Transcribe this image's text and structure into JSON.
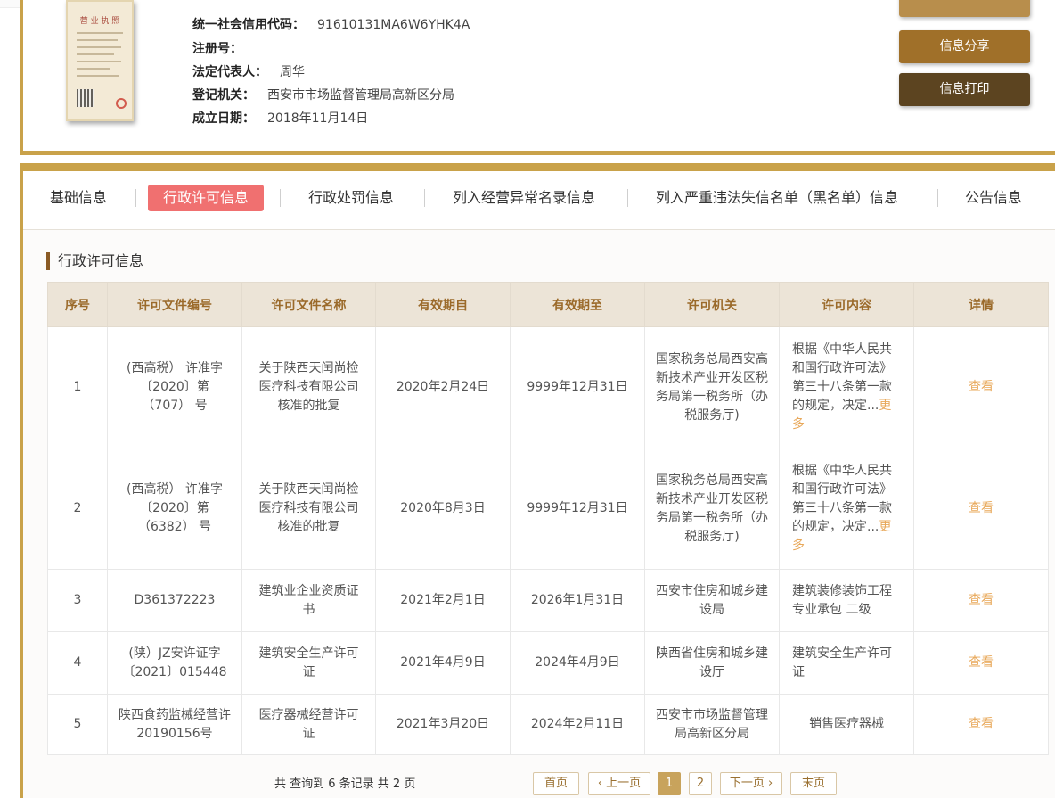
{
  "company_info": {
    "credit_code_label": "统一社会信用代码：",
    "credit_code_value": "91610131MA6W6YHK4A",
    "reg_no_label": "注册号：",
    "reg_no_value": "",
    "legal_rep_label": "法定代表人：",
    "legal_rep_value": "周华",
    "authority_label": "登记机关：",
    "authority_value": "西安市市场监督管理局高新区分局",
    "established_label": "成立日期：",
    "established_value": "2018年11月14日",
    "license_image_title": "营 业 执 照"
  },
  "actions": {
    "share_label": "信息分享",
    "print_label": "信息打印"
  },
  "tabs": [
    {
      "label": "基础信息",
      "active": false
    },
    {
      "label": "行政许可信息",
      "active": true
    },
    {
      "label": "行政处罚信息",
      "active": false
    },
    {
      "label": "列入经营异常名录信息",
      "active": false
    },
    {
      "label": "列入严重违法失信名单（黑名单）信息",
      "active": false
    },
    {
      "label": "公告信息",
      "active": false
    }
  ],
  "section_title": "行政许可信息",
  "table": {
    "headers": [
      "序号",
      "许可文件编号",
      "许可文件名称",
      "有效期自",
      "有效期至",
      "许可机关",
      "许可内容",
      "详情"
    ],
    "rows": [
      {
        "no": "1",
        "doc_no": "(西高税） 许准字〔2020〕第（707） 号",
        "doc_name": "关于陕西天闰尚检医疗科技有限公司核准的批复",
        "valid_from": "2020年2月24日",
        "valid_to": "9999年12月31日",
        "authority": "国家税务总局西安高新技术产业开发区税务局第一税务所（办税服务厅)",
        "content": "根据《中华人民共和国行政许可法》第三十八条第一款的规定，决定...",
        "more": "更多",
        "detail": "查看"
      },
      {
        "no": "2",
        "doc_no": "(西高税） 许准字〔2020〕第（6382） 号",
        "doc_name": "关于陕西天闰尚检医疗科技有限公司核准的批复",
        "valid_from": "2020年8月3日",
        "valid_to": "9999年12月31日",
        "authority": "国家税务总局西安高新技术产业开发区税务局第一税务所（办税服务厅)",
        "content": "根据《中华人民共和国行政许可法》第三十八条第一款的规定，决定...",
        "more": "更多",
        "detail": "查看"
      },
      {
        "no": "3",
        "doc_no": "D361372223",
        "doc_name": "建筑业企业资质证书",
        "valid_from": "2021年2月1日",
        "valid_to": "2026年1月31日",
        "authority": "西安市住房和城乡建设局",
        "content": "建筑装修装饰工程专业承包 二级",
        "more": "",
        "detail": "查看"
      },
      {
        "no": "4",
        "doc_no": "(陕）JZ安许证字〔2021〕015448",
        "doc_name": "建筑安全生产许可证",
        "valid_from": "2021年4月9日",
        "valid_to": "2024年4月9日",
        "authority": "陕西省住房和城乡建设厅",
        "content": "建筑安全生产许可证",
        "more": "",
        "detail": "查看"
      },
      {
        "no": "5",
        "doc_no": "陕西食药监械经营许20190156号",
        "doc_name": "医疗器械经营许可证",
        "valid_from": "2021年3月20日",
        "valid_to": "2024年2月11日",
        "authority": "西安市市场监督管理局高新区分局",
        "content": "销售医疗器械",
        "more": "",
        "detail": "查看"
      }
    ]
  },
  "pagination": {
    "summary": "共 查询到 6 条记录 共 2 页",
    "first": "首页",
    "prev": "‹ 上一页",
    "page1": "1",
    "page2": "2",
    "next": "下一页 ›",
    "last": "末页"
  }
}
